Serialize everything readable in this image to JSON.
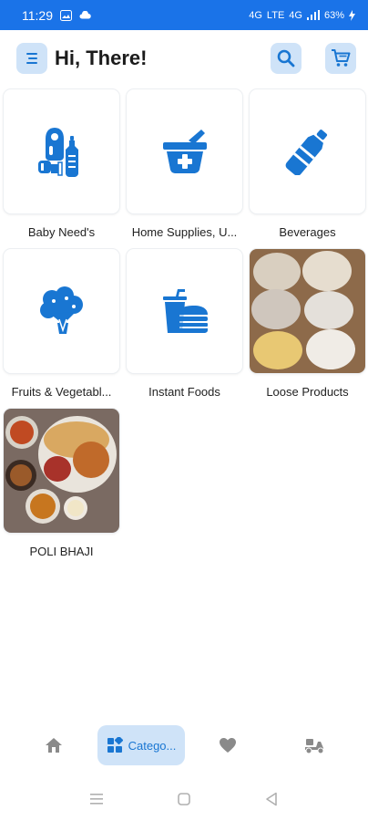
{
  "status_bar": {
    "time": "11:29",
    "battery": "63%",
    "network_1": "4G",
    "network_2": "LTE",
    "network_3": "4G"
  },
  "header": {
    "greeting": "Hi, There!"
  },
  "categories": [
    {
      "label": "Baby Need's",
      "icon": "baby-bottle-icon",
      "kind": "icon"
    },
    {
      "label": "Home Supplies, U...",
      "icon": "mortar-pestle-icon",
      "kind": "icon"
    },
    {
      "label": "Beverages",
      "icon": "bottle-icon",
      "kind": "icon"
    },
    {
      "label": "Fruits & Vegetabl...",
      "icon": "broccoli-icon",
      "kind": "icon"
    },
    {
      "label": "Instant Foods",
      "icon": "burger-drink-icon",
      "kind": "icon"
    },
    {
      "label": "Loose Products",
      "icon": "grains-photo",
      "kind": "photo"
    },
    {
      "label": "POLI BHAJI",
      "icon": "thali-photo",
      "kind": "photo"
    }
  ],
  "bottom_nav": {
    "active_label": "Catego...",
    "items": [
      "home-icon",
      "category-icon",
      "heart-icon",
      "delivery-scooter-icon"
    ]
  },
  "colors": {
    "primary": "#1a73e8",
    "icon_blue": "#1976d2",
    "chip_bg": "#cfe3f8",
    "inactive_icon": "#8a8a8a"
  }
}
